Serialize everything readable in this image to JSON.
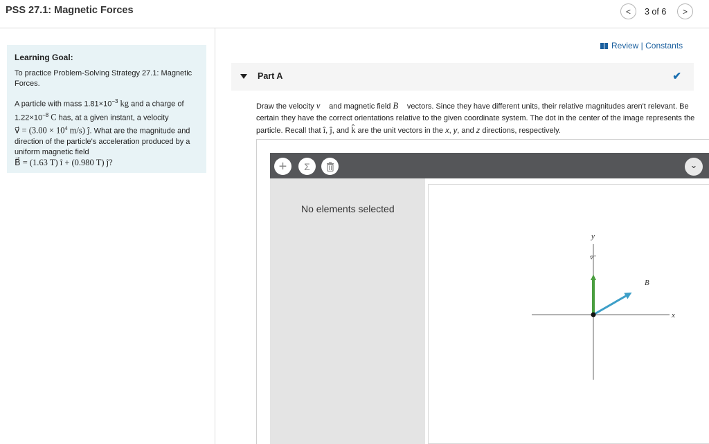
{
  "header": {
    "title": "PSS 27.1: Magnetic Forces",
    "prev_icon": "chevron-left-icon",
    "next_icon": "chevron-right-icon",
    "prev_glyph": "<",
    "next_glyph": ">",
    "page_count": "3 of 6"
  },
  "goal": {
    "title": "Learning Goal:",
    "intro": "To practice Problem-Solving Strategy 27.1: Magnetic Forces.",
    "p1": "A particle with mass 1.81×10",
    "p1_exp": "−3",
    "p1_unit": "kg",
    "p1b": " and a charge of 1.22×10",
    "p1b_exp": "−8",
    "p1b_unit": "C",
    "p1c": " has, at a given instant, a velocity",
    "velocity_eq": "v⃗ = (3.00 × 10",
    "velocity_exp": "4",
    "velocity_eq2": " m/s) ĵ",
    "p2": ". What are the magnitude and direction of the particle's acceleration produced by a uniform magnetic field",
    "field_eq": "B⃗ = (1.63 T) î + (0.980 T) ĵ",
    "q_mark": "?"
  },
  "review": {
    "icon": "book-icon",
    "label": "Review | Constants"
  },
  "part": {
    "label": "Part A",
    "caret_icon": "caret-down-icon",
    "check_icon": "checkmark-icon",
    "check_glyph": "✔"
  },
  "instructions": {
    "line1a": "Draw the velocity ",
    "v_sym": "v⃗",
    "line1b": " and magnetic field ",
    "b_sym": "B⃗",
    "line1c": " vectors. Since they have different units, their relative magnitudes aren't relevant. Be certain they have the correct orientations relative to the given coordinate system. The dot in the center of the image represents the particle. Recall that ",
    "i_sym": "î",
    "sep1": ", ",
    "j_sym": "ĵ",
    "sep2": ", and ",
    "k_sym": "k̂",
    "line1d": " are the unit vectors in the ",
    "x_word": "x",
    "c1": ", ",
    "y_word": "y",
    "c2": ", and ",
    "z_word": "z",
    "line1e": " directions, respectively."
  },
  "toolbar": {
    "add_glyph": "+",
    "sum_glyph": "Σ",
    "dropdown_glyph": "⌄"
  },
  "side_panel": {
    "text": "No elements selected"
  },
  "graph": {
    "x_label": "x",
    "y_label": "y",
    "v_label": "v⃗",
    "b_label": "B⃗",
    "vectors": [
      {
        "name": "v",
        "color": "#4a9e3f",
        "direction": "+y"
      },
      {
        "name": "B",
        "color": "#3d9fc8",
        "direction": "+x +y"
      }
    ]
  },
  "colors": {
    "accent": "#1a5f9e",
    "goal_bg": "#e8f3f6",
    "toolbar_bg": "#555659",
    "velocity": "#4a9e3f",
    "field": "#3d9fc8"
  }
}
